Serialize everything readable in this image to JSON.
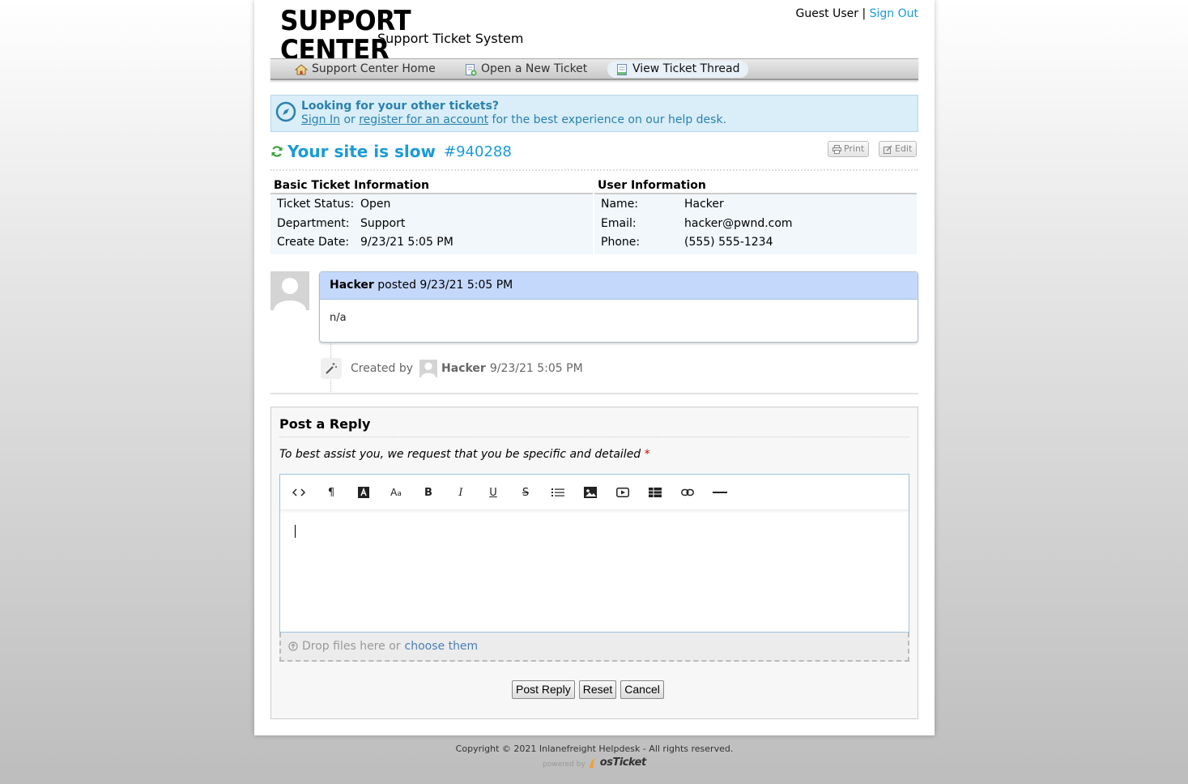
{
  "header": {
    "logo_title": "SUPPORT CENTER",
    "logo_subtitle": "Support Ticket System",
    "user_label": "Guest User",
    "separator": "|",
    "signout_label": "Sign Out"
  },
  "nav": {
    "items": [
      {
        "label": "Support Center Home",
        "icon": "home-icon"
      },
      {
        "label": "Open a New Ticket",
        "icon": "new-ticket-icon"
      },
      {
        "label": "View Ticket Thread",
        "icon": "ticket-thread-icon",
        "active": true
      }
    ]
  },
  "notice": {
    "title": "Looking for your other tickets?",
    "signin_label": "Sign In",
    "or_text": "or",
    "register_label": "register for an account",
    "rest_text": "for the best experience on our help desk."
  },
  "ticket": {
    "subject": "Your site is slow",
    "number": "#940288",
    "print_label": "Print",
    "edit_label": "Edit"
  },
  "basic_info": {
    "heading": "Basic Ticket Information",
    "rows": [
      {
        "key": "Ticket Status:",
        "value": "Open"
      },
      {
        "key": "Department:",
        "value": "Support"
      },
      {
        "key": "Create Date:",
        "value": "9/23/21 5:05 PM"
      }
    ]
  },
  "user_info": {
    "heading": "User Information",
    "rows": [
      {
        "key": "Name:",
        "value": "Hacker"
      },
      {
        "key": "Email:",
        "value": "hacker@pwnd.com"
      },
      {
        "key": "Phone:",
        "value": "(555) 555-1234"
      }
    ]
  },
  "thread": {
    "author": "Hacker",
    "posted_text": "posted 9/23/21 5:05 PM",
    "body": "n/a",
    "event_prefix": "Created by",
    "event_author": "Hacker",
    "event_time": "9/23/21 5:05 PM"
  },
  "reply": {
    "heading": "Post a Reply",
    "instruction": "To best assist you, we request that you be specific and detailed",
    "required_mark": "*",
    "toolbar": [
      "code-view-icon",
      "paragraph-icon",
      "font-color-icon",
      "font-size-icon",
      "bold-icon",
      "italic-icon",
      "underline-icon",
      "strikethrough-icon",
      "list-icon",
      "image-icon",
      "video-icon",
      "table-icon",
      "link-icon",
      "horizontal-rule-icon"
    ],
    "drop_text": "Drop files here or",
    "choose_label": "choose them",
    "post_label": "Post Reply",
    "reset_label": "Reset",
    "cancel_label": "Cancel"
  },
  "footer": {
    "copyright": "Copyright © 2021 Inlanefreight Helpdesk - All rights reserved.",
    "powered_by": "powered by",
    "brand": "osTicket"
  },
  "colors": {
    "accent": "#1a9bd7",
    "notice_bg": "#d9eef8",
    "thread_header_bg": "#c4d8fc"
  }
}
